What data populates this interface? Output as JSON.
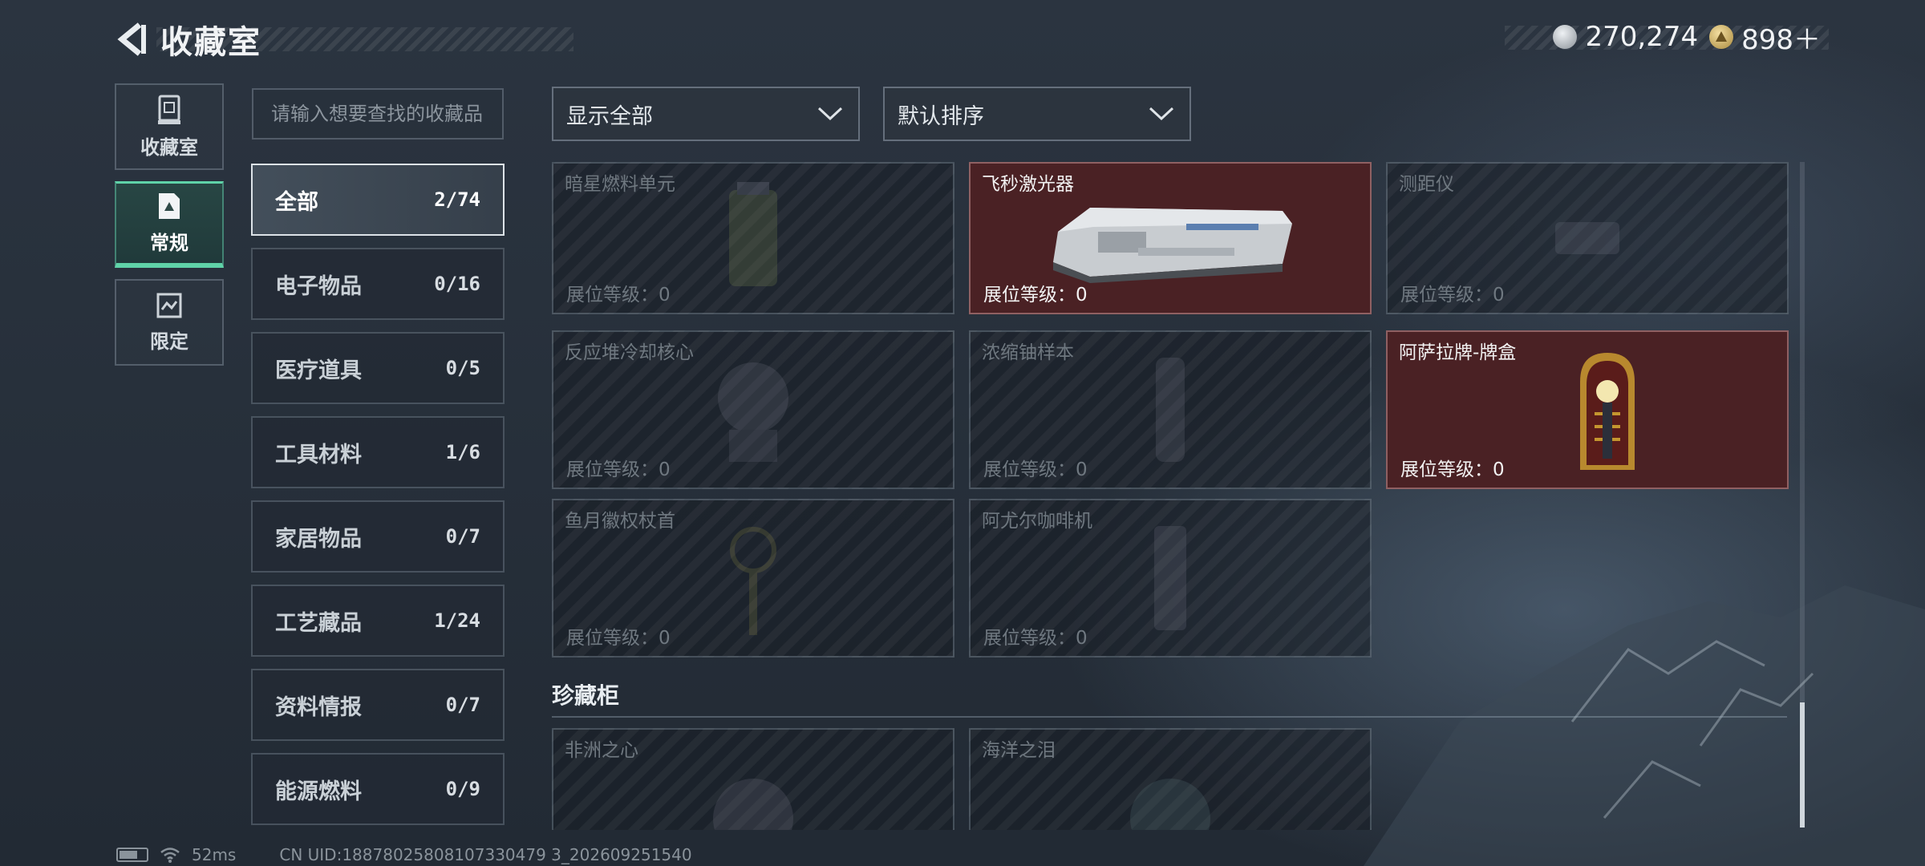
{
  "header": {
    "title": "收藏室",
    "currencies": [
      {
        "icon": "silver-coin-icon",
        "value": "270,274"
      },
      {
        "icon": "gold-triangle-coin-icon",
        "value": "898＋"
      }
    ]
  },
  "left_nav": [
    {
      "label": "收藏室",
      "icon": "display-case-icon",
      "active": false
    },
    {
      "label": "常规",
      "icon": "document-icon",
      "active": true
    },
    {
      "label": "限定",
      "icon": "limited-card-icon",
      "active": false
    }
  ],
  "search": {
    "placeholder": "请输入想要查找的收藏品"
  },
  "categories": [
    {
      "label": "全部",
      "count": "2/74",
      "active": true
    },
    {
      "label": "电子物品",
      "count": "0/16"
    },
    {
      "label": "医疗道具",
      "count": "0/5"
    },
    {
      "label": "工具材料",
      "count": "1/6"
    },
    {
      "label": "家居物品",
      "count": "0/7"
    },
    {
      "label": "工艺藏品",
      "count": "1/24"
    },
    {
      "label": "资料情报",
      "count": "0/7"
    },
    {
      "label": "能源燃料",
      "count": "0/9"
    }
  ],
  "filters": {
    "display": "显示全部",
    "sort": "默认排序"
  },
  "items": [
    {
      "name": "暗星燃料单元",
      "level": "展位等级：0",
      "owned": false,
      "icon": "fuel-cell-icon"
    },
    {
      "name": "飞秒激光器",
      "level": "展位等级：0",
      "owned": true,
      "icon": "laser-device-icon"
    },
    {
      "name": "测距仪",
      "level": "展位等级：0",
      "owned": false,
      "icon": "rangefinder-icon"
    },
    {
      "name": "反应堆冷却核心",
      "level": "展位等级：0",
      "owned": false,
      "icon": "reactor-core-icon"
    },
    {
      "name": "浓缩铀样本",
      "level": "展位等级：0",
      "owned": false,
      "icon": "uranium-sample-icon"
    },
    {
      "name": "阿萨拉牌-牌盒",
      "level": "展位等级：0",
      "owned": true,
      "icon": "card-box-icon"
    },
    {
      "name": "鱼月徽权杖首",
      "level": "展位等级：0",
      "owned": false,
      "icon": "scepter-head-icon"
    },
    {
      "name": "阿尤尔咖啡机",
      "level": "展位等级：0",
      "owned": false,
      "icon": "coffee-machine-icon"
    }
  ],
  "section": {
    "title": "珍藏柜"
  },
  "treasure_items": [
    {
      "name": "非洲之心",
      "owned": false,
      "icon": "gem-icon"
    },
    {
      "name": "海洋之泪",
      "owned": false,
      "icon": "pearl-icon"
    }
  ],
  "footer": {
    "ping": "52ms",
    "uid": "CN UID:18878025808107330479 3_202609251540"
  }
}
